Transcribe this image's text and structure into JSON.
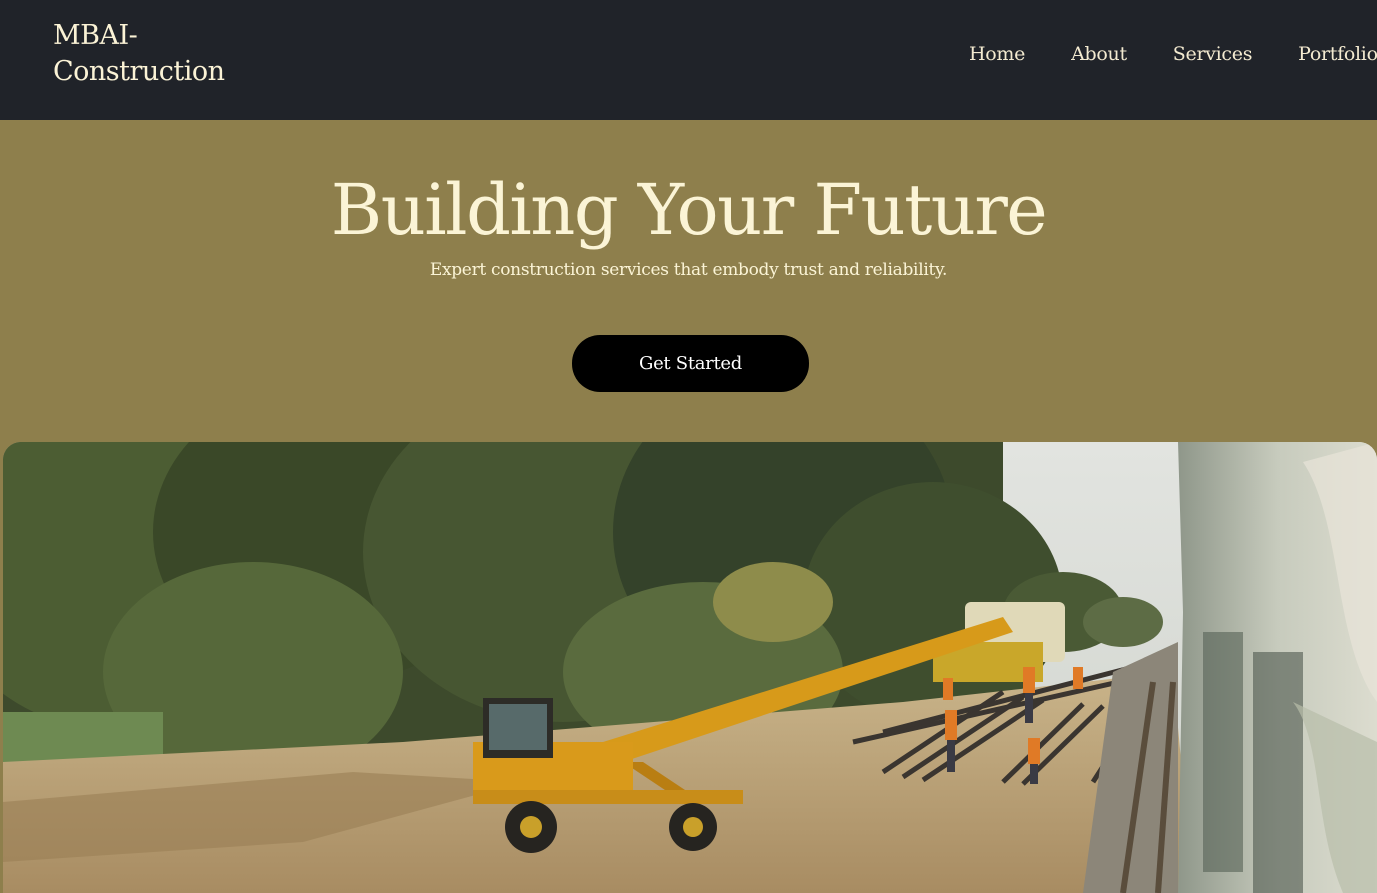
{
  "header": {
    "brand_line1": "MBAI-",
    "brand_line2": "Construction",
    "nav": [
      {
        "label": "Home"
      },
      {
        "label": "About"
      },
      {
        "label": "Services"
      },
      {
        "label": "Portfolio"
      }
    ]
  },
  "hero": {
    "title": "Building Your Future",
    "subtitle": "Expert construction services that embody trust and reliability.",
    "cta_label": "Get Started",
    "image_alt": "Construction crew and yellow crane loading steel rails beside a railway track"
  },
  "colors": {
    "nav_bg": "#202329",
    "hero_bg": "#8e7f4c",
    "hero_text": "#fbf4d6",
    "cta_bg": "#000000",
    "cta_text": "#ffffff"
  }
}
